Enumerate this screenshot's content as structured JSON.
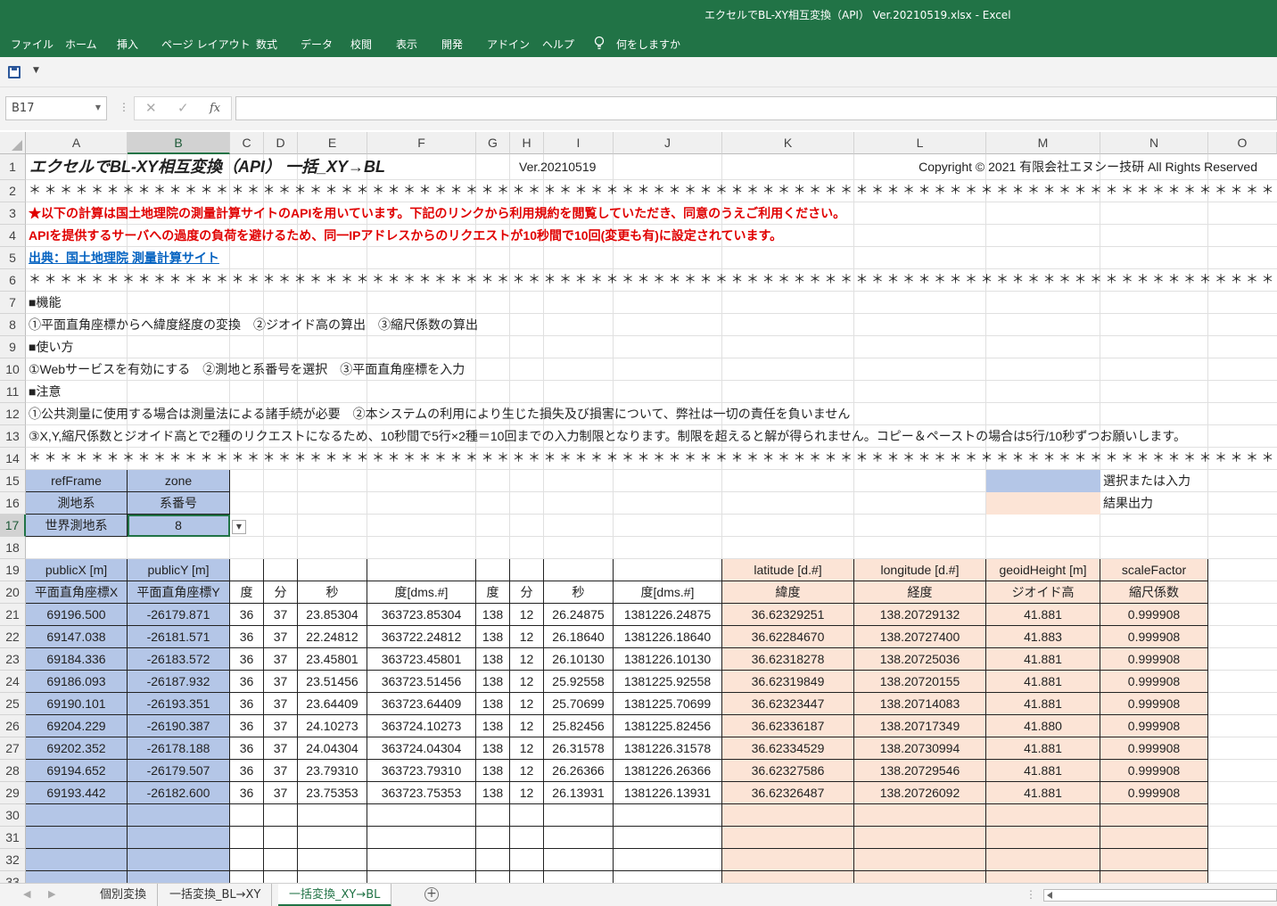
{
  "window": {
    "title": "エクセルでBL-XY相互変換（API） Ver.20210519.xlsx  -  Excel"
  },
  "ribbon": {
    "tabs": [
      "ファイル",
      "ホーム",
      "挿入",
      "ページ レイアウト",
      "数式",
      "データ",
      "校閲",
      "表示",
      "開発",
      "アドイン",
      "ヘルプ"
    ],
    "tell_me": "何をしますか"
  },
  "formula_bar": {
    "name_box": "B17",
    "fx": "fx",
    "value": ""
  },
  "columns": [
    "A",
    "B",
    "C",
    "D",
    "E",
    "F",
    "G",
    "H",
    "I",
    "J",
    "K",
    "L",
    "M",
    "N",
    "O"
  ],
  "rows": [
    "1",
    "2",
    "3",
    "4",
    "5",
    "6",
    "7",
    "8",
    "9",
    "10",
    "11",
    "12",
    "13",
    "14",
    "15",
    "16",
    "17",
    "18",
    "19",
    "20",
    "21",
    "22",
    "23",
    "24",
    "25",
    "26",
    "27",
    "28",
    "29",
    "30",
    "31",
    "32",
    "33"
  ],
  "sheet": {
    "title": "エクセルでBL-XY相互変換（API） 一括_XY→BL",
    "version": "Ver.20210519",
    "copyright": "Copyright © 2021 有限会社エヌシー技研  All Rights Reserved",
    "stars": "＊＊＊＊＊＊＊＊＊＊＊＊＊＊＊＊＊＊＊＊＊＊＊＊＊＊＊＊＊＊＊＊＊＊＊＊＊＊＊＊＊＊＊＊＊＊＊＊＊＊＊＊＊＊＊＊＊＊＊＊＊＊＊＊＊＊＊＊＊＊＊＊＊＊＊＊＊＊＊＊＊＊＊＊＊＊＊＊＊",
    "notice1": "★以下の計算は国土地理院の測量計算サイトのAPIを用いています。下記のリンクから利用規約を閲覧していただき、同意のうえご利用ください。",
    "notice2": "APIを提供するサーバへの過度の負荷を避けるため、同一IPアドレスからのリクエストが10秒間で10回(変更も有)に設定されています。",
    "source_link": "出典：国土地理院 測量計算サイト",
    "features_heading": "■機能",
    "features": "①平面直角座標からへ緯度経度の変換　②ジオイド高の算出　③縮尺係数の算出",
    "usage_heading": "■使い方",
    "usage": "①Webサービスを有効にする　②測地と系番号を選択　③平面直角座標を入力",
    "caution_heading": "■注意",
    "caution1": "①公共測量に使用する場合は測量法による諸手続が必要　②本システムの利用により生じた損失及び損害について、弊社は一切の責任を負いません",
    "caution2": "③X,Y,縮尺係数とジオイド高とで2種のリクエストになるため、10秒間で5行×2種＝10回までの入力制限となります。制限を超えると解が得られません。コピー＆ペーストの場合は5行/10秒ずつお願いします。",
    "params": {
      "refFrame_label": "refFrame",
      "zone_label": "zone",
      "refFrame_jp": "測地系",
      "zone_jp": "系番号",
      "refFrame_value": "世界測地系",
      "zone_value": "8"
    },
    "legend": {
      "input": "選択または入力",
      "output": "結果出力"
    },
    "table_headers": {
      "row19": [
        "publicX [m]",
        "publicY [m]",
        "latitude [d.#]",
        "longitude [d.#]",
        "geoidHeight [m]",
        "scaleFactor"
      ],
      "row20": [
        "平面直角座標X",
        "平面直角座標Y",
        "度",
        "分",
        "秒",
        "度[dms.#]",
        "度",
        "分",
        "秒",
        "度[dms.#]",
        "緯度",
        "経度",
        "ジオイド高",
        "縮尺係数"
      ]
    },
    "data_rows": [
      [
        "69196.500",
        "-26179.871",
        "36",
        "37",
        "23.85304",
        "363723.85304",
        "138",
        "12",
        "26.24875",
        "1381226.24875",
        "36.62329251",
        "138.20729132",
        "41.881",
        "0.999908"
      ],
      [
        "69147.038",
        "-26181.571",
        "36",
        "37",
        "22.24812",
        "363722.24812",
        "138",
        "12",
        "26.18640",
        "1381226.18640",
        "36.62284670",
        "138.20727400",
        "41.883",
        "0.999908"
      ],
      [
        "69184.336",
        "-26183.572",
        "36",
        "37",
        "23.45801",
        "363723.45801",
        "138",
        "12",
        "26.10130",
        "1381226.10130",
        "36.62318278",
        "138.20725036",
        "41.881",
        "0.999908"
      ],
      [
        "69186.093",
        "-26187.932",
        "36",
        "37",
        "23.51456",
        "363723.51456",
        "138",
        "12",
        "25.92558",
        "1381225.92558",
        "36.62319849",
        "138.20720155",
        "41.881",
        "0.999908"
      ],
      [
        "69190.101",
        "-26193.351",
        "36",
        "37",
        "23.64409",
        "363723.64409",
        "138",
        "12",
        "25.70699",
        "1381225.70699",
        "36.62323447",
        "138.20714083",
        "41.881",
        "0.999908"
      ],
      [
        "69204.229",
        "-26190.387",
        "36",
        "37",
        "24.10273",
        "363724.10273",
        "138",
        "12",
        "25.82456",
        "1381225.82456",
        "36.62336187",
        "138.20717349",
        "41.880",
        "0.999908"
      ],
      [
        "69202.352",
        "-26178.188",
        "36",
        "37",
        "24.04304",
        "363724.04304",
        "138",
        "12",
        "26.31578",
        "1381226.31578",
        "36.62334529",
        "138.20730994",
        "41.881",
        "0.999908"
      ],
      [
        "69194.652",
        "-26179.507",
        "36",
        "37",
        "23.79310",
        "363723.79310",
        "138",
        "12",
        "26.26366",
        "1381226.26366",
        "36.62327586",
        "138.20729546",
        "41.881",
        "0.999908"
      ],
      [
        "69193.442",
        "-26182.600",
        "36",
        "37",
        "23.75353",
        "363723.75353",
        "138",
        "12",
        "26.13931",
        "1381226.13931",
        "36.62326487",
        "138.20726092",
        "41.881",
        "0.999908"
      ]
    ]
  },
  "sheet_tabs": [
    "個別変換",
    "一括変換_BL→XY",
    "一括変換_XY→BL"
  ],
  "active_sheet": "一括変換_XY→BL",
  "colors": {
    "excel_green": "#217346",
    "input_blue": "#b4c6e7",
    "output_peach": "#fce4d6",
    "notice_red": "#e00000",
    "link_blue": "#0563c1"
  }
}
